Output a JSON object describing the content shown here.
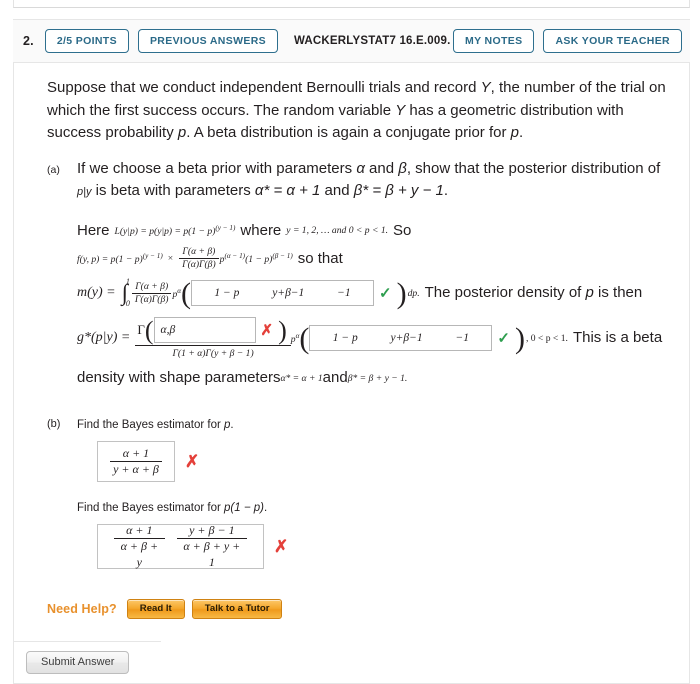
{
  "header": {
    "question_number": "2.",
    "points_label": "2/5 POINTS",
    "previous_answers_label": "PREVIOUS ANSWERS",
    "question_code": "WACKERLYSTAT7 16.E.009.",
    "my_notes_label": "MY NOTES",
    "ask_teacher_label": "ASK YOUR TEACHER",
    "accent_color": "#2b6a88"
  },
  "stem": {
    "line1_a": "Suppose that we conduct independent Bernoulli trials and record ",
    "var_Y1": "Y",
    "line1_b": ", the number of the trial on which the first success occurs. The random variable ",
    "var_Y2": "Y",
    "line1_c": " has a geometric distribution with success probability ",
    "var_p1": "p",
    "line1_d": ". A beta distribution is again a conjugate prior for ",
    "var_p2": "p",
    "line1_e": "."
  },
  "part_a": {
    "label": "(a)",
    "text_1": "If we choose a beta prior with parameters ",
    "alpha": "α",
    "text_2": " and ",
    "beta": "β",
    "text_3": ", show that the posterior distribution of ",
    "p_given_y": "p|y",
    "text_4": " is beta with parameters ",
    "alpha_star_eq": "α* = α + 1",
    "text_5": " and ",
    "beta_star_eq": "β* = β + y − 1",
    "text_6": ".",
    "work": {
      "here_word": "Here",
      "likelihood": "L(y|p) = p(y|p) = p(1 − p)",
      "likelihood_exp": "(y − 1)",
      "where_word": "where",
      "support": "y = 1, 2, … and 0 < p < 1.",
      "so_word": "So",
      "joint_lhs": "f(y, p) = p(1 − p)",
      "joint_exp": "(y − 1)",
      "times": "×",
      "gamma_num": "Γ(α + β)",
      "gamma_den": "Γ(α)Γ(β)",
      "joint_tail_p": "p",
      "joint_tail_p_exp": "(α − 1)",
      "joint_tail_q": "(1 − p)",
      "joint_tail_q_exp": "(β − 1)",
      "so_that": "so that",
      "my_lhs": "m(y) =",
      "int_upper": "1",
      "int_lower": "0",
      "my_box_base": "1 − p",
      "my_box_exp1": "y+β−1",
      "my_box_exp2": "−1",
      "my_box_mark": "✓",
      "dp": "dp.",
      "my_tail": "The posterior density of ",
      "my_tail_p": "p",
      "my_tail_2": " is then",
      "g_lhs": "g*(p|y) =",
      "g_gamma": "Γ",
      "g_box1_value": "α,β",
      "g_box1_mark": "✗",
      "g_den": "Γ(1 + α)Γ(y + β − 1)",
      "g_p": "p",
      "g_p_exp": "α",
      "g_box2_base": "1 − p",
      "g_box2_exp1": "y+β−1",
      "g_box2_exp2": "−1",
      "g_box2_mark": "✓",
      "g_range": ", 0 < p < 1.",
      "g_tail": "This is a beta",
      "final_1": "density with shape parameters ",
      "final_alpha": "α* = α + 1",
      "final_and": " and ",
      "final_beta": "β* = β + y − 1.",
      "check_color": "#2e9e4f",
      "cross_color": "#e4403a"
    }
  },
  "part_b": {
    "label": "(b)",
    "prompt_1": "Find the Bayes estimator for ",
    "prompt_1_var": "p",
    "prompt_1_end": ".",
    "answer_1": {
      "numerator": "α + 1",
      "denominator": "y + α + β",
      "mark": "✗"
    },
    "prompt_2": "Find the Bayes estimator for ",
    "prompt_2_var": "p(1 − p)",
    "prompt_2_end": ".",
    "answer_2": {
      "frac1_num": "α + 1",
      "frac1_den": "α + β + y",
      "frac2_num": "y + β − 1",
      "frac2_den": "α + β + y + 1",
      "mark": "✗"
    }
  },
  "need_help": {
    "label": "Need Help?",
    "read_it_label": "Read It",
    "tutor_label": "Talk to a Tutor",
    "color": "#e8912d"
  },
  "footer": {
    "submit_label": "Submit Answer"
  }
}
